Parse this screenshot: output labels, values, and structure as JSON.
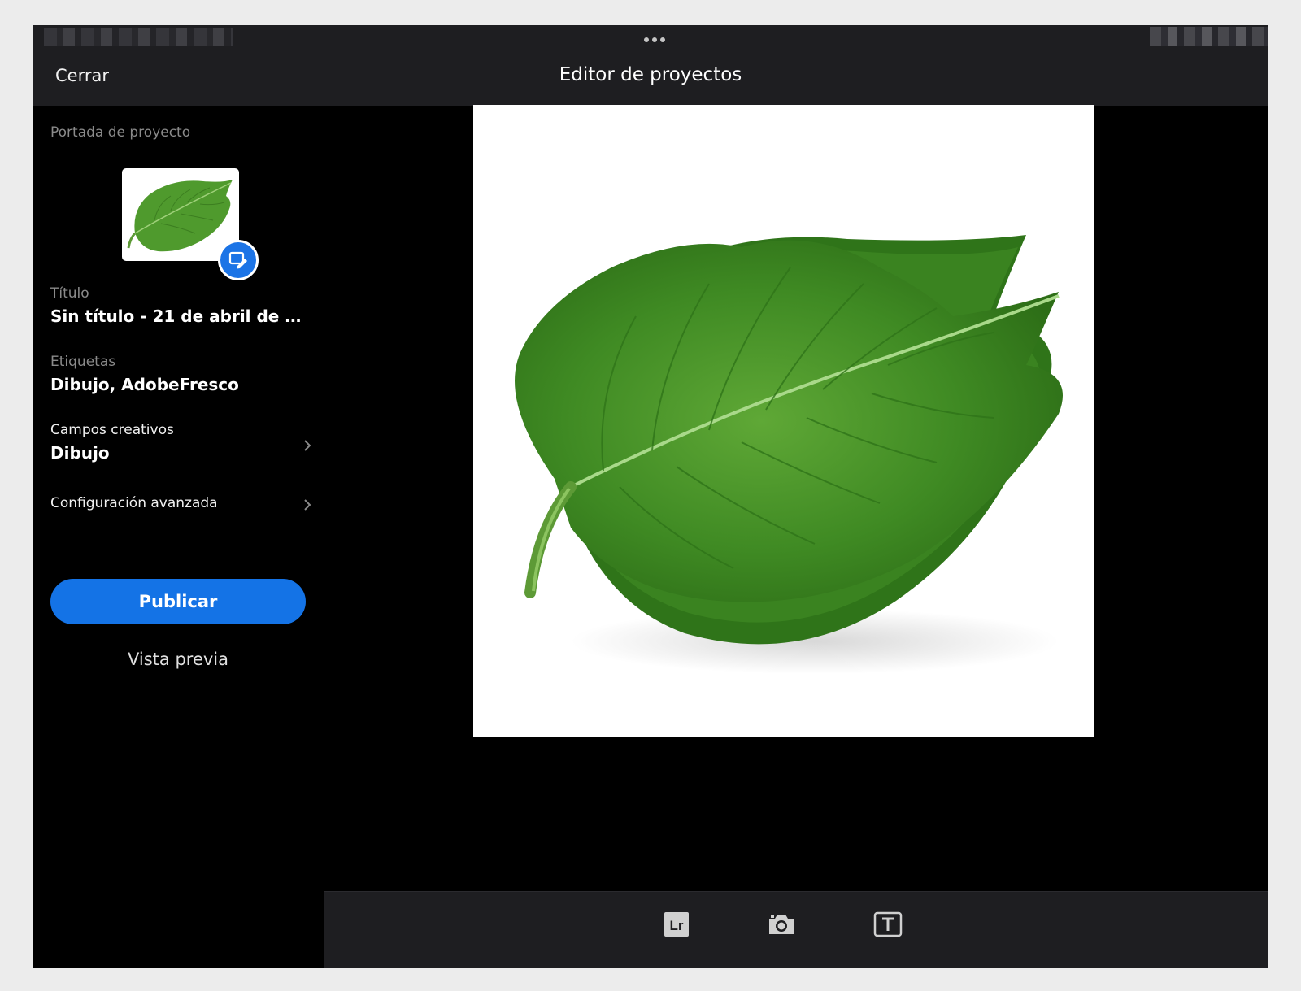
{
  "header": {
    "close_label": "Cerrar",
    "title": "Editor de proyectos"
  },
  "sidebar": {
    "cover_label": "Portada de proyecto",
    "title_label": "Título",
    "title_value": "Sin título - 21 de abril de 2026...",
    "tags_label": "Etiquetas",
    "tags_value": "Dibujo, AdobeFresco",
    "creative_fields_label": "Campos creativos",
    "creative_fields_value": "Dibujo",
    "advanced_label": "Configuración avanzada",
    "publish_label": "Publicar",
    "preview_label": "Vista previa"
  },
  "toolbar": {
    "lightroom_label": "Lr"
  },
  "colors": {
    "accent": "#1473e6",
    "background": "#000000",
    "bar": "#1e1e21"
  },
  "icons": {
    "edit_cover": "edit-cover-icon",
    "chevron": "chevron-right-icon",
    "lightroom": "lightroom-icon",
    "camera": "camera-icon",
    "text": "text-icon"
  }
}
